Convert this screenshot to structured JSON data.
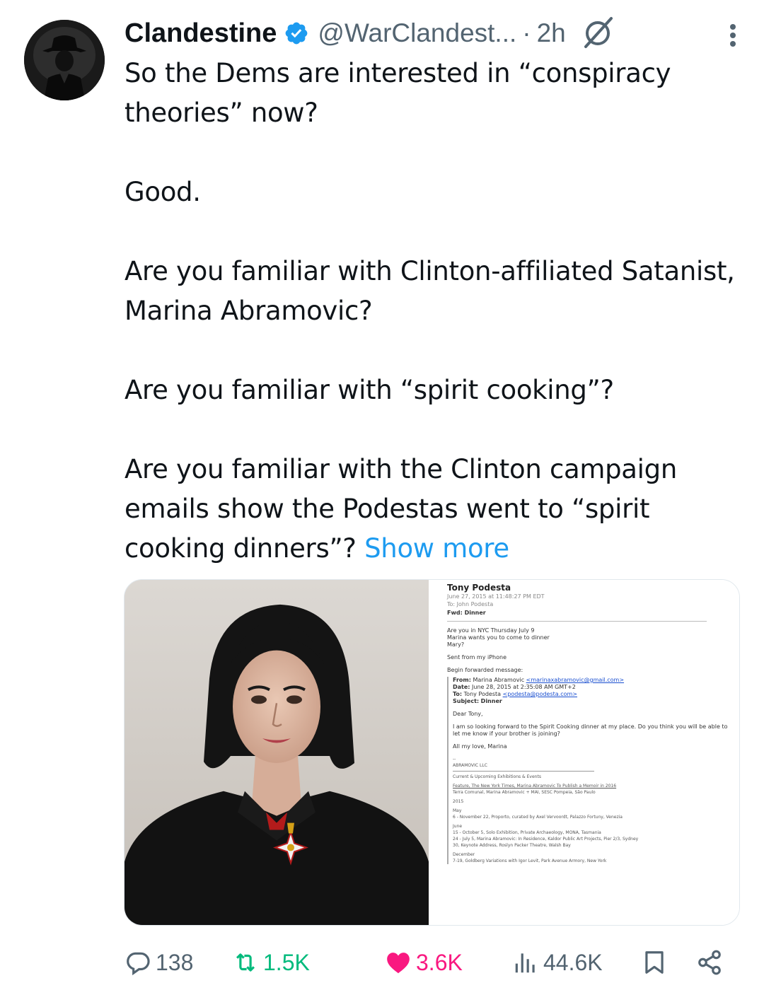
{
  "author": {
    "display_name": "Clandestine",
    "handle": "@WarClandest...",
    "separator": "·",
    "time": "2h",
    "verified_color": "#1d9bf0"
  },
  "icons": {
    "verified": "verified-badge-icon",
    "grok": "grok-icon",
    "more": "more-options-icon",
    "reply": "reply-icon",
    "retweet": "retweet-icon",
    "like": "heart-icon",
    "views": "views-chart-icon",
    "bookmark": "bookmark-icon",
    "share": "share-icon"
  },
  "tweet": {
    "line1": "So the Dems are interested in “conspiracy theories” now?",
    "line2": "Good.",
    "line3": "Are you familiar with Clinton-affiliated Satanist, Marina Abramovic?",
    "line4": "Are you familiar with “spirit cooking”?",
    "line5": "Are you familiar with the Clinton campaign emails show the Podestas went to “spirit cooking dinners”?",
    "show_more": "Show more",
    "link_color": "#1d9bf0"
  },
  "email": {
    "from": "Tony Podesta",
    "date": "June 27, 2015 at 11:48:27 PM EDT",
    "to": "To: John Podesta",
    "subject": "Fwd: Dinner",
    "body1": "Are you in NYC Thursday July 9",
    "body2": "Marina wants you to come to dinner",
    "body3": "Mary?",
    "sent_from": "Sent from my iPhone",
    "begin_fwd": "Begin forwarded message:",
    "q_from_label": "From:",
    "q_from": "Marina Abramovic",
    "q_from_email": "<marinaxabramovic@gmail.com>",
    "q_date_label": "Date:",
    "q_date": "June 28, 2015 at 2:35:08 AM GMT+2",
    "q_to_label": "To:",
    "q_to": "Tony Podesta",
    "q_to_email": "<podesta@podesta.com>",
    "q_subject_label": "Subject:",
    "q_subject": "Dinner",
    "greeting": "Dear Tony,",
    "message": "I am so looking forward to the Spirit Cooking dinner at my place. Do you think you will be able to let me know if your brother is joining?",
    "signoff": "All my love, Marina",
    "dashes": "--",
    "sig_company": "ABRAMOVIC LLC",
    "sig_current": "Current & Upcoming Exhibitions & Events",
    "sig_feature": "Feature, The New York Times, Marina Abramovic To Publish a Memoir in 2016",
    "sig_terra": "Terra Comunal, Marina Abramovic + MAI, SESC Pompeia, São Paulo",
    "sig_year": "2015",
    "sig_may": "May",
    "sig_may_item": "6 - November 22, Proporto, curated by Axel Vervoordt, Palazzo Fortuny, Venezia",
    "sig_june": "June",
    "sig_june_item1": "15 - October 5, Solo Exhibition, Private Archaeology, MONA, Tasmania",
    "sig_june_item2": "24 - July 5, Marina Abramovic: In Residence, Kaldor Public Art Projects, Pier 2/3, Sydney",
    "sig_june_item3": "30, Keynote Address, Roslyn Packer Theatre, Walsh Bay",
    "sig_dec": "December",
    "sig_dec_item": "7-19, Goldberg Variations with Igor Levit, Park Avenue Armory, New York"
  },
  "stats": {
    "replies": "138",
    "retweets": "1.5K",
    "likes": "3.6K",
    "views": "44.6K",
    "retweet_color": "#00ba7c",
    "like_color": "#f91880",
    "muted_color": "#536471"
  }
}
